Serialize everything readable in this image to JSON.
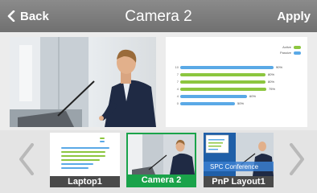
{
  "topbar": {
    "back_label": "Back",
    "title": "Camera 2",
    "apply_label": "Apply"
  },
  "preview_chart": {
    "legend": [
      {
        "name": "Active",
        "color": "#8cc63f"
      },
      {
        "name": "Passive",
        "color": "#5aa9e6"
      }
    ],
    "chart_data": {
      "type": "bar",
      "categories": [
        "10",
        "7",
        "7",
        "4",
        "4",
        "0"
      ],
      "values": [
        98,
        90,
        90,
        91,
        70,
        58
      ],
      "value_labels": [
        "90%",
        "80%",
        "80%",
        "75%",
        "60%",
        "50%"
      ],
      "colors": [
        "#5aa9e6",
        "#8cc63f",
        "#8cc63f",
        "#8cc63f",
        "#5aa9e6",
        "#5aa9e6"
      ]
    }
  },
  "sources": [
    {
      "label": "Laptop1",
      "selected": false
    },
    {
      "label": "Camera 2",
      "selected": true
    },
    {
      "label": "PnP Layout1",
      "selected": false,
      "overlay_text": "SPC Conference"
    }
  ],
  "icons": {
    "back": "chevron-left-icon",
    "prev": "chevron-left-icon",
    "next": "chevron-right-icon"
  }
}
